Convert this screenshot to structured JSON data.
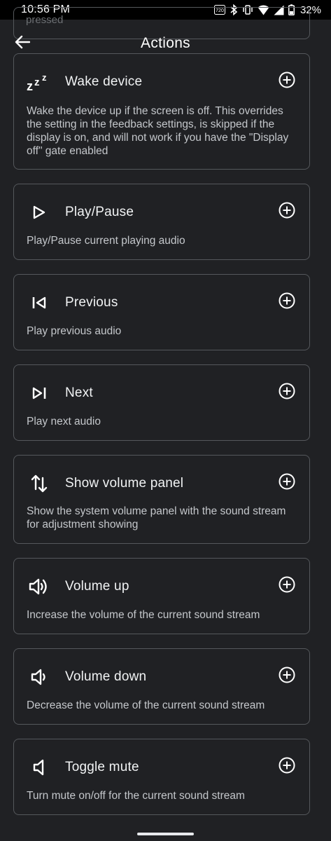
{
  "status_bar": {
    "time": "10:56 PM",
    "battery": "32%",
    "icons": [
      "hd-icon",
      "bluetooth-icon",
      "vibrate-icon",
      "wifi-icon",
      "signal-icon",
      "battery-icon"
    ]
  },
  "background_item": {
    "text": "pressed"
  },
  "app_bar": {
    "title": "Actions",
    "back_icon": "arrow-back-icon"
  },
  "actions": [
    {
      "icon": "zzz-icon",
      "title": "Wake device",
      "description": "Wake the device up if the screen is off. This overrides the setting in the feedback settings, is skipped if the display is on, and will not work if you have the \"Display off\" gate enabled"
    },
    {
      "icon": "play-icon",
      "title": "Play/Pause",
      "description": "Play/Pause current playing audio"
    },
    {
      "icon": "skip-previous-icon",
      "title": "Previous",
      "description": "Play previous audio"
    },
    {
      "icon": "skip-next-icon",
      "title": "Next",
      "description": "Play next audio"
    },
    {
      "icon": "swap-vertical-icon",
      "title": "Show volume panel",
      "description": "Show the system volume panel with the sound stream for adjustment showing"
    },
    {
      "icon": "volume-up-icon",
      "title": "Volume up",
      "description": "Increase the volume of the current sound stream"
    },
    {
      "icon": "volume-down-icon",
      "title": "Volume down",
      "description": "Decrease the volume of the current sound stream"
    },
    {
      "icon": "volume-mute-icon",
      "title": "Toggle mute",
      "description": "Turn mute on/off for the current sound stream"
    }
  ],
  "add_icon": "add-circle-icon",
  "colors": {
    "background": "#202124",
    "card_border": "#55585c",
    "text": "#f1f3f4",
    "secondary_text": "#c4c7cb"
  }
}
